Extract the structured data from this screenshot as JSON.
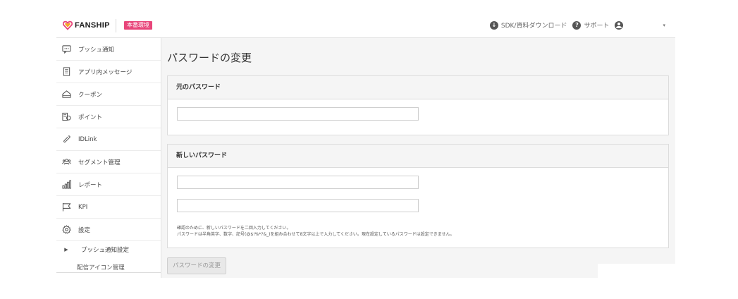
{
  "header": {
    "logo_text": "FANSHIP",
    "env_badge": "本番環境",
    "sdk_link": "SDK/資料ダウンロード",
    "support_link": "サポート",
    "caret": "▾",
    "brand_color": "#e8457a"
  },
  "sidebar": {
    "items": [
      {
        "label": "プッシュ通知",
        "icon": "chat-bubble-icon"
      },
      {
        "label": "アプリ内メッセージ",
        "icon": "document-icon"
      },
      {
        "label": "クーポン",
        "icon": "coupon-icon"
      },
      {
        "label": "ポイント",
        "icon": "point-icon"
      },
      {
        "label": "IDLink",
        "icon": "link-icon"
      },
      {
        "label": "セグメント管理",
        "icon": "users-icon"
      },
      {
        "label": "レポート",
        "icon": "bar-chart-icon"
      },
      {
        "label": "KPI",
        "icon": "flag-icon"
      },
      {
        "label": "設定",
        "icon": "gear-icon"
      }
    ],
    "sub_item": "プッシュ通知設定",
    "sub_arrow": "▶",
    "sub_item2": "配信アイコン管理"
  },
  "main": {
    "title": "パスワードの変更",
    "old_password": {
      "heading": "元のパスワード",
      "value": ""
    },
    "new_password": {
      "heading": "新しいパスワード",
      "value": "",
      "confirm_value": "",
      "note_line1": "確認のために、新しいパスワードを二回入力してください。",
      "note_line2": "パスワードは半角英字、数字、記号(@$!%*?&_)を組み合わせて8文字以上で入力してください。現在設定しているパスワードは設定できません。"
    },
    "submit_label": "パスワードの変更"
  }
}
